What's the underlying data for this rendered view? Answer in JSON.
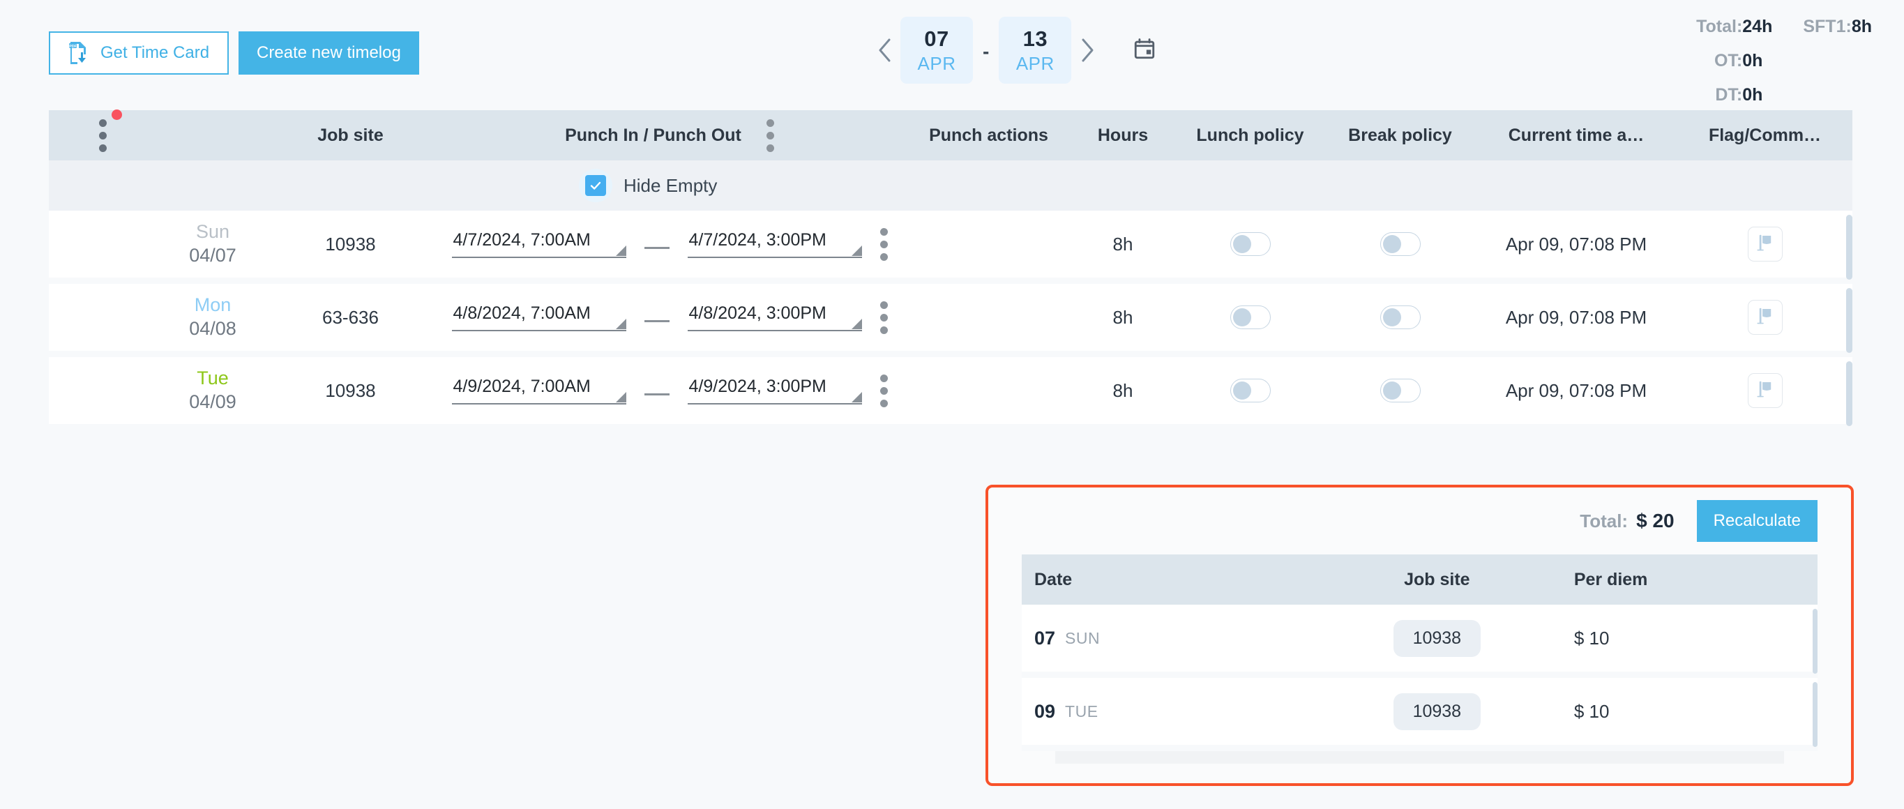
{
  "toolbar": {
    "get_time_card_label": "Get Time Card",
    "create_timelog_label": "Create new timelog"
  },
  "date_nav": {
    "prev_label": "‹",
    "next_label": "›",
    "start": {
      "day": "07",
      "month": "APR"
    },
    "separator": "-",
    "end": {
      "day": "13",
      "month": "APR"
    }
  },
  "totals": {
    "total_label": "Total:",
    "total_value": "24h",
    "shift_label": "SFT1:",
    "shift_value": "8h",
    "ot_label": "OT:",
    "ot_value": "0h",
    "dt_label": "DT:",
    "dt_value": "0h"
  },
  "table": {
    "columns": {
      "job_site": "Job site",
      "punch": "Punch In / Punch Out",
      "punch_actions": "Punch actions",
      "hours": "Hours",
      "lunch_policy": "Lunch policy",
      "break_policy": "Break policy",
      "current_time": "Current time a…",
      "flag_comment": "Flag/Comm…"
    },
    "hide_empty_label": "Hide Empty",
    "hide_empty_checked": true,
    "rows": [
      {
        "day_name": "Sun",
        "day_date": "04/07",
        "day_color": "#b9c0c7",
        "job_site": "10938",
        "punch_in": "4/7/2024, 7:00AM",
        "punch_out": "4/7/2024, 3:00PM",
        "hours": "8h",
        "lunch_on": false,
        "break_on": false,
        "current_time": "Apr 09, 07:08 PM"
      },
      {
        "day_name": "Mon",
        "day_date": "04/08",
        "day_color": "#8ecdf5",
        "job_site": "63-636",
        "punch_in": "4/8/2024, 7:00AM",
        "punch_out": "4/8/2024, 3:00PM",
        "hours": "8h",
        "lunch_on": false,
        "break_on": false,
        "current_time": "Apr 09, 07:08 PM"
      },
      {
        "day_name": "Tue",
        "day_date": "04/09",
        "day_color": "#8dc71a",
        "job_site": "10938",
        "punch_in": "4/9/2024, 7:00AM",
        "punch_out": "4/9/2024, 3:00PM",
        "hours": "8h",
        "lunch_on": false,
        "break_on": false,
        "current_time": "Apr 09, 07:08 PM"
      }
    ]
  },
  "per_diem": {
    "total_label": "Total:",
    "total_value": "$ 20",
    "recalculate_label": "Recalculate",
    "columns": {
      "date": "Date",
      "job_site": "Job site",
      "per_diem": "Per diem"
    },
    "rows": [
      {
        "day_num": "07",
        "day_name": "SUN",
        "job_site": "10938",
        "amount": "$ 10"
      },
      {
        "day_num": "09",
        "day_name": "TUE",
        "job_site": "10938",
        "amount": "$ 10"
      }
    ]
  },
  "colors": {
    "accent": "#44b4e6",
    "highlight_border": "#f8522a",
    "header_bg": "#dce5ec",
    "badge": "#f9525f"
  }
}
